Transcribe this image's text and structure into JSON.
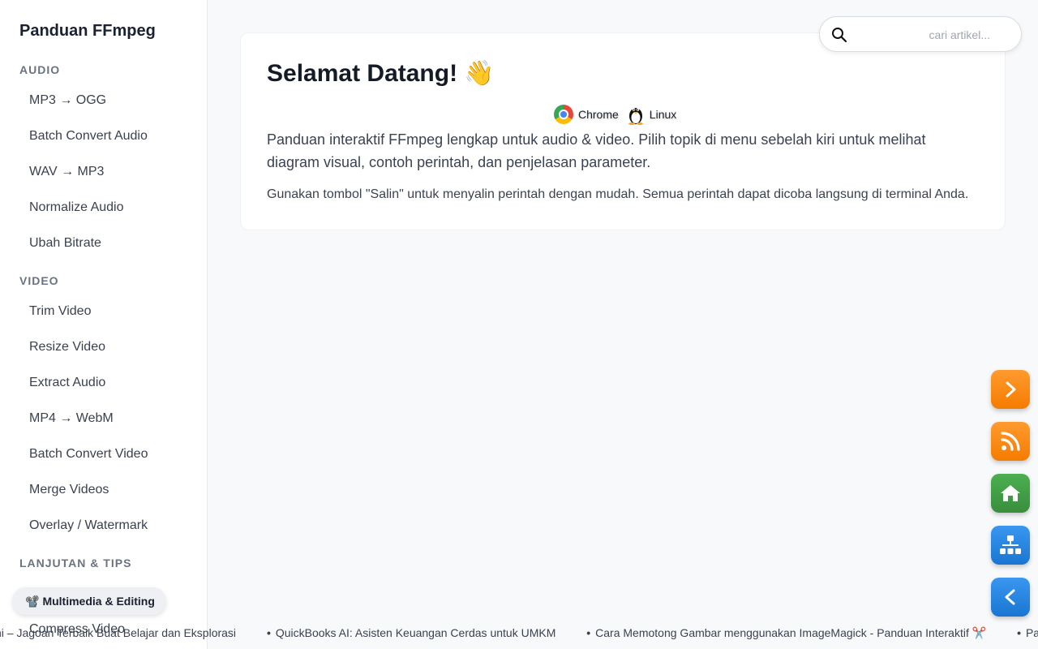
{
  "sidebar": {
    "title": "Panduan FFmpeg",
    "sections": [
      {
        "label": "AUDIO",
        "items": [
          "MP3 → OGG",
          "Batch Convert Audio",
          "WAV → MP3",
          "Normalize Audio",
          "Ubah Bitrate"
        ]
      },
      {
        "label": "VIDEO",
        "items": [
          "Trim Video",
          "Resize Video",
          "Extract Audio",
          "MP4 → WebM",
          "Batch Convert Video",
          "Merge Videos",
          "Overlay / Watermark"
        ]
      },
      {
        "label": "LANJUTAN & TIPS",
        "items": [
          "Compress Video"
        ]
      }
    ],
    "chip": {
      "icon": "📽️",
      "label": "Multimedia & Editing"
    }
  },
  "search": {
    "placeholder": "cari artikel..."
  },
  "main": {
    "title": "Selamat Datang! 👋",
    "badges": [
      {
        "icon": "chrome-icon",
        "label": "Chrome"
      },
      {
        "icon": "linux-tux-icon",
        "label": "Linux"
      }
    ],
    "lead": "Panduan interaktif FFmpeg lengkap untuk audio & video. Pilih topik di menu sebelah kiri untuk melihat diagram visual, contoh perintah, dan penjelasan parameter.",
    "note": "Gunakan tombol \"Salin\" untuk menyalin perintah dengan mudah. Semua perintah dapat dicoba langsung di terminal Anda."
  },
  "floating_buttons": [
    {
      "icon": "chevron-right-icon",
      "color": "#f57c00"
    },
    {
      "icon": "rss-icon",
      "color": "#f57c00"
    },
    {
      "icon": "home-icon",
      "color": "#388e3c"
    },
    {
      "icon": "sitemap-icon",
      "color": "#1976d2"
    },
    {
      "icon": "chevron-left-icon",
      "color": "#1976d2"
    }
  ],
  "ticker": [
    "ni – Jagoan Terbaik Buat Belajar dan Eksplorasi",
    "QuickBooks AI: Asisten Keuangan Cerdas untuk UMKM",
    "Cara Memotong Gambar menggunakan ImageMagick - Panduan Interaktif ✂️",
    "Panduan"
  ]
}
